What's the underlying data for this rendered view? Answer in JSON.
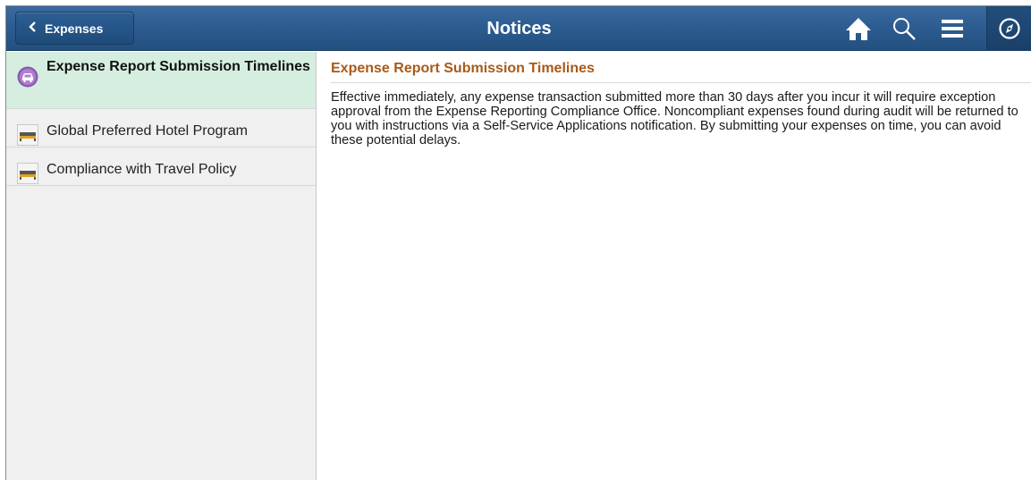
{
  "header": {
    "back_label": "Expenses",
    "title": "Notices",
    "icons": [
      "home-icon",
      "search-icon",
      "menu-icon",
      "navbar-compass-icon"
    ],
    "background": "#2c5b90"
  },
  "notices": [
    {
      "label": "Expense Report Submission Timelines",
      "icon": "car-icon",
      "selected": true
    },
    {
      "label": "Global Preferred Hotel Program",
      "icon": "bed-icon",
      "selected": false
    },
    {
      "label": "Compliance with Travel Policy",
      "icon": "bed-icon",
      "selected": false
    }
  ],
  "detail": {
    "title": "Expense Report Submission Timelines",
    "body": "Effective immediately, any expense transaction submitted more than 30 days after you incur it will require exception approval from the Expense Reporting Compliance Office. Noncompliant expenses found during audit will be returned to you with instructions via a Self-Service Applications notification. By submitting your expenses on time, you can avoid these potential delays.",
    "title_color": "#a85a18"
  },
  "colors": {
    "selected_row": "#d5eee0",
    "left_panel": "#f0f0f0"
  }
}
